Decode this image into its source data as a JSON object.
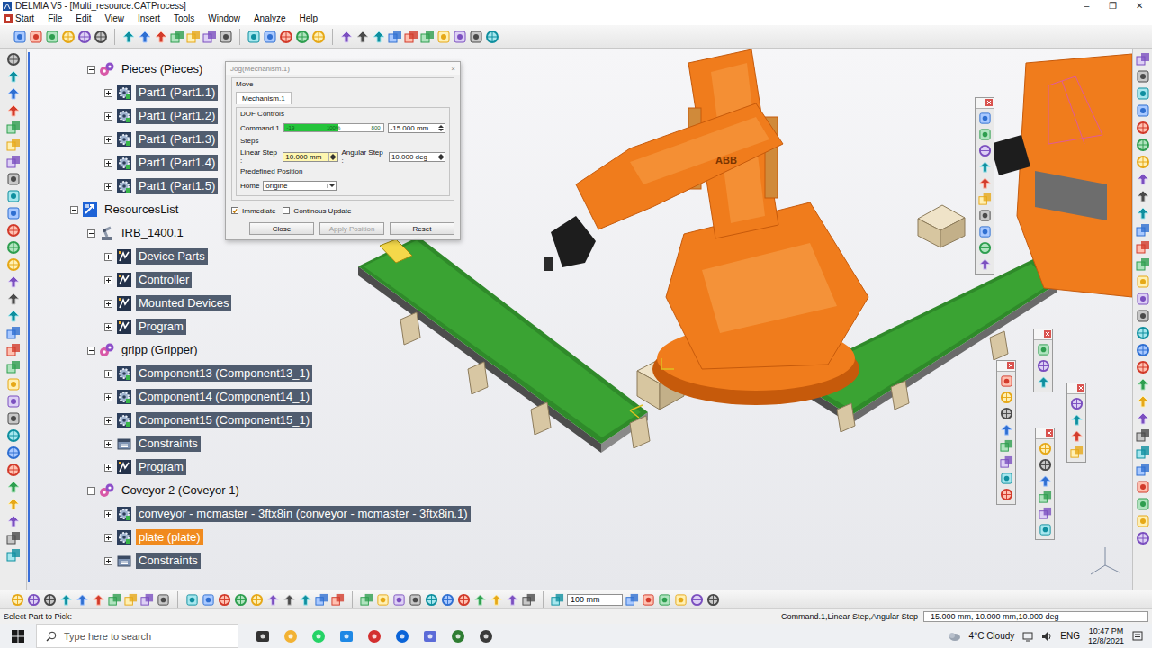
{
  "window": {
    "title": "DELMIA V5 - [Multi_resource.CATProcess]",
    "controls": [
      "–",
      "❐",
      "✕"
    ]
  },
  "menu": [
    "Start",
    "File",
    "Edit",
    "View",
    "Insert",
    "Tools",
    "Window",
    "Analyze",
    "Help"
  ],
  "tree": [
    {
      "label": "Pieces (Pieces)",
      "level": 1,
      "kind": "product",
      "expanded": true,
      "highlighted": false,
      "selected": false
    },
    {
      "label": "Part1 (Part1.1)",
      "level": 2,
      "kind": "part",
      "expanded": false,
      "highlighted": true,
      "selected": false
    },
    {
      "label": "Part1 (Part1.2)",
      "level": 2,
      "kind": "part",
      "expanded": false,
      "highlighted": true,
      "selected": false
    },
    {
      "label": "Part1 (Part1.3)",
      "level": 2,
      "kind": "part",
      "expanded": false,
      "highlighted": true,
      "selected": false
    },
    {
      "label": "Part1 (Part1.4)",
      "level": 2,
      "kind": "part",
      "expanded": false,
      "highlighted": true,
      "selected": false
    },
    {
      "label": "Part1 (Part1.5)",
      "level": 2,
      "kind": "part",
      "expanded": false,
      "highlighted": true,
      "selected": false
    },
    {
      "label": "ResourcesList",
      "level": 0,
      "kind": "resources",
      "expanded": true,
      "highlighted": false,
      "selected": false
    },
    {
      "label": "IRB_1400.1",
      "level": 1,
      "kind": "robot",
      "expanded": true,
      "highlighted": false,
      "selected": false
    },
    {
      "label": "Device Parts",
      "level": 2,
      "kind": "node",
      "expanded": false,
      "highlighted": true,
      "selected": false
    },
    {
      "label": "Controller",
      "level": 2,
      "kind": "node",
      "expanded": false,
      "highlighted": true,
      "selected": false
    },
    {
      "label": "Mounted Devices",
      "level": 2,
      "kind": "node",
      "expanded": false,
      "highlighted": true,
      "selected": false
    },
    {
      "label": "Program",
      "level": 2,
      "kind": "node",
      "expanded": false,
      "highlighted": true,
      "selected": false
    },
    {
      "label": "gripp (Gripper)",
      "level": 1,
      "kind": "product",
      "expanded": true,
      "highlighted": false,
      "selected": false
    },
    {
      "label": "Component13 (Component13_1)",
      "level": 2,
      "kind": "part",
      "expanded": false,
      "highlighted": true,
      "selected": false
    },
    {
      "label": "Component14 (Component14_1)",
      "level": 2,
      "kind": "part",
      "expanded": false,
      "highlighted": true,
      "selected": false
    },
    {
      "label": "Component15 (Component15_1)",
      "level": 2,
      "kind": "part",
      "expanded": false,
      "highlighted": true,
      "selected": false
    },
    {
      "label": "Constraints",
      "level": 2,
      "kind": "constraints",
      "expanded": false,
      "highlighted": true,
      "selected": false
    },
    {
      "label": "Program",
      "level": 2,
      "kind": "node",
      "expanded": false,
      "highlighted": true,
      "selected": false
    },
    {
      "label": "Coveyor 2 (Coveyor 1)",
      "level": 1,
      "kind": "product",
      "expanded": true,
      "highlighted": false,
      "selected": false
    },
    {
      "label": "conveyor - mcmaster - 3ftx8in (conveyor - mcmaster - 3ftx8in.1)",
      "level": 2,
      "kind": "part",
      "expanded": false,
      "highlighted": true,
      "selected": false
    },
    {
      "label": "plate (plate)",
      "level": 2,
      "kind": "part",
      "expanded": false,
      "highlighted": true,
      "selected": true
    },
    {
      "label": "Constraints",
      "level": 2,
      "kind": "constraints",
      "expanded": false,
      "highlighted": true,
      "selected": false
    }
  ],
  "scene": {
    "logo": "ABB"
  },
  "dialog": {
    "title": "Jog(Mechanism.1)",
    "close": "×",
    "group": "Move",
    "tabs": [
      {
        "label": "Mechanism.1",
        "selected": true
      }
    ],
    "dof_label": "DOF Controls",
    "commands": [
      {
        "name": "Command.1",
        "level": 0.55,
        "min": "-19",
        "mid": "100%",
        "max": "800",
        "value": "-15.000 mm"
      }
    ],
    "steps_label": "Steps",
    "linear_label": "Linear Step :",
    "linear_value": "10.000 mm",
    "angular_label": "Angular Step :",
    "angular_value": "10.000 deg",
    "predefined_label": "Predefined Position",
    "home_label": "Home",
    "home_value": "origine",
    "options": [
      {
        "label": "Immediate",
        "checked": true
      },
      {
        "label": "Continous Update",
        "checked": false
      }
    ],
    "buttons": [
      {
        "label": "Close",
        "disabled": false
      },
      {
        "label": "Apply Position",
        "disabled": true
      },
      {
        "label": "Reset",
        "disabled": false
      }
    ]
  },
  "bottom_toolbar": {
    "scale": "100 mm"
  },
  "status_bar": {
    "prompt": "Select Part to Pick:",
    "command": "Command.1,Linear Step,Angular Step",
    "value": "-15.000 mm, 10.000 mm,10.000 deg"
  },
  "taskbar": {
    "search": "Type here to search",
    "weather": "4°C  Cloudy",
    "language": "ENG",
    "time": "10:47 PM",
    "date": "12/8/2021"
  }
}
